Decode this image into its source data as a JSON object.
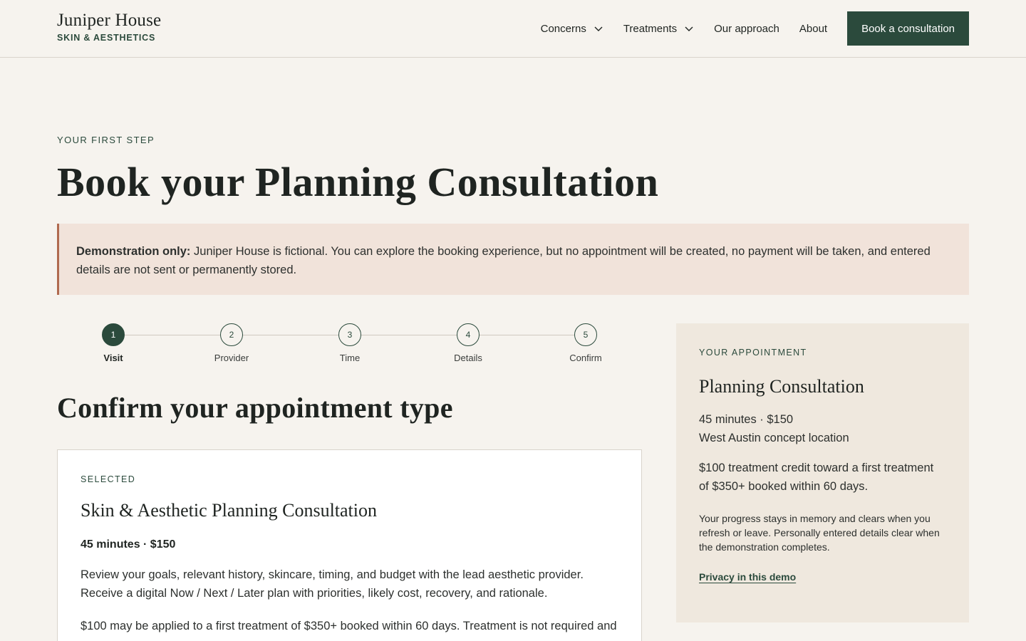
{
  "brand": {
    "name": "Juniper House",
    "tagline": "SKIN & AESTHETICS"
  },
  "nav": {
    "items": [
      {
        "label": "Concerns",
        "has_dropdown": true
      },
      {
        "label": "Treatments",
        "has_dropdown": true
      },
      {
        "label": "Our approach",
        "has_dropdown": false
      },
      {
        "label": "About",
        "has_dropdown": false
      }
    ],
    "cta_label": "Book a consultation"
  },
  "hero": {
    "eyebrow": "YOUR FIRST STEP",
    "title": "Book your Planning Consultation"
  },
  "notice": {
    "lead": "Demonstration only:",
    "text": " Juniper House is fictional. You can explore the booking experience, but no appointment will be created, no payment will be taken, and entered details are not sent or permanently stored."
  },
  "stepper": {
    "steps": [
      {
        "number": "1",
        "label": "Visit",
        "active": true
      },
      {
        "number": "2",
        "label": "Provider",
        "active": false
      },
      {
        "number": "3",
        "label": "Time",
        "active": false
      },
      {
        "number": "4",
        "label": "Details",
        "active": false
      },
      {
        "number": "5",
        "label": "Confirm",
        "active": false
      }
    ]
  },
  "section": {
    "title": "Confirm your appointment type"
  },
  "card": {
    "eyebrow": "SELECTED",
    "title": "Skin & Aesthetic Planning Consultation",
    "meta": "45 minutes · $150",
    "description": "Review your goals, relevant history, skincare, timing, and budget with the lead aesthetic provider. Receive a digital Now / Next / Later plan with priorities, likely cost, recovery, and rationale.",
    "credit": "$100 may be applied to a first treatment of $350+ booked within 60 days. Treatment is not required and"
  },
  "sidebar": {
    "eyebrow": "YOUR APPOINTMENT",
    "title": "Planning Consultation",
    "duration_price": "45 minutes · $150",
    "location": "West Austin concept location",
    "credit": "$100 treatment credit toward a first treatment of $350+ booked within 60 days.",
    "note": "Your progress stays in memory and clears when you refresh or leave. Personally entered details clear when the demonstration completes.",
    "link_label": "Privacy in this demo"
  },
  "colors": {
    "accent": "#2b4a3c",
    "background": "#f6f3ee",
    "notice_bg": "#f1e3da",
    "notice_border": "#b06a4f",
    "sidebar_bg": "#efe8de"
  }
}
